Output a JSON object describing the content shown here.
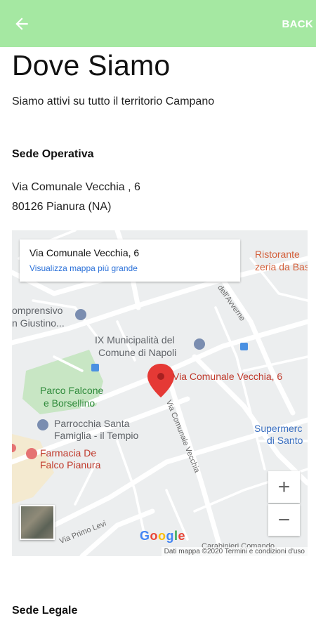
{
  "header": {
    "back_label": "BACK"
  },
  "page": {
    "title": "Dove Siamo",
    "subtitle": "Siamo attivi su tutto il territorio Campano",
    "operativa_heading": "Sede Operativa",
    "address_line1": "Via Comunale Vecchia , 6",
    "address_line2": "80126 Pianura (NA)",
    "legale_heading": "Sede Legale"
  },
  "map": {
    "info_title": "Via Comunale Vecchia, 6",
    "info_link": "Visualizza mappa più grande",
    "marker_label": "Via Comunale Vecchia, 6",
    "labels": {
      "municipalita_1": "IX Municipalità del",
      "municipalita_2": "Comune di Napoli",
      "parco_1": "Parco Falcone",
      "parco_2": "e Borsellino",
      "parrocchia_1": "Parrocchia Santa",
      "parrocchia_2": "Famiglia - il Tempio",
      "farmacia_1": "Farmacia De",
      "farmacia_2": "Falco Pianura",
      "ristorante_1": "Ristorante",
      "ristorante_2": "zeria da Basili",
      "comprensivo_1": "omprensivo",
      "comprensivo_2": "n Giustino...",
      "supermercato_1": "Supermerc",
      "supermercato_2": "di Santo",
      "street_comunale": "Via Comunale Vecchia",
      "street_primo_levi": "Via Primo Levi",
      "street_avverne": "dell'Avverne",
      "carabinieri": "Carabinieri Comando"
    },
    "google_logo": "Google",
    "attribution": "Dati mappa ©2020   Termini e condizioni d'uso",
    "zoom_in": "+",
    "zoom_out": "−"
  },
  "colors": {
    "appbar": "#a5e8a2",
    "marker": "#e53935",
    "link": "#2d72d9"
  }
}
